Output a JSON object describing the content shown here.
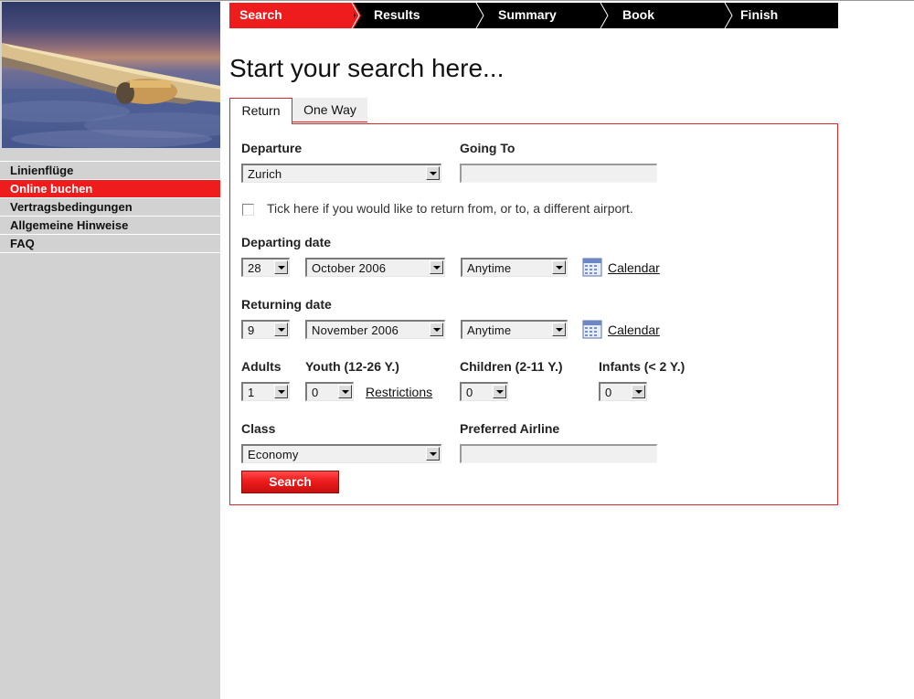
{
  "sidebar": {
    "items": [
      {
        "label": "Linienflüge"
      },
      {
        "label": "Online buchen"
      },
      {
        "label": "Vertragsbedingungen"
      },
      {
        "label": "Allgemeine Hinweise"
      },
      {
        "label": "FAQ"
      }
    ],
    "active_index": 1
  },
  "steps": [
    {
      "label": "Search"
    },
    {
      "label": "Results"
    },
    {
      "label": "Summary"
    },
    {
      "label": "Book"
    },
    {
      "label": "Finish"
    }
  ],
  "page_title": "Start your search here...",
  "tabs": [
    {
      "label": "Return"
    },
    {
      "label": "One Way"
    }
  ],
  "form": {
    "departure_label": "Departure",
    "departure_value": "Zurich",
    "going_to_label": "Going To",
    "going_to_value": "",
    "different_airport_label": "Tick here if you would like to return from, or to, a different airport.",
    "departing_date_label": "Departing date",
    "departing_day": "28",
    "departing_month": "October 2006",
    "departing_time": "Anytime",
    "returning_date_label": "Returning date",
    "returning_day": "9",
    "returning_month": "November 2006",
    "returning_time": "Anytime",
    "calendar_label": "Calendar",
    "adults_label": "Adults",
    "adults_value": "1",
    "youth_label": "Youth (12-26 Y.)",
    "youth_value": "0",
    "restrictions_label": "Restrictions",
    "children_label": "Children (2-11 Y.)",
    "children_value": "0",
    "infants_label": "Infants (< 2 Y.)",
    "infants_value": "0",
    "class_label": "Class",
    "class_value": "Economy",
    "preferred_airline_label": "Preferred Airline",
    "preferred_airline_value": "",
    "search_button": "Search"
  },
  "colors": {
    "accent": "#ee1c1c",
    "panel_border": "#d62828",
    "sidebar_bg": "#d2d2d2",
    "steps_bg": "#000000"
  },
  "icons": {
    "calendar": "calendar-icon",
    "dropdown": "chevron-down-icon"
  }
}
